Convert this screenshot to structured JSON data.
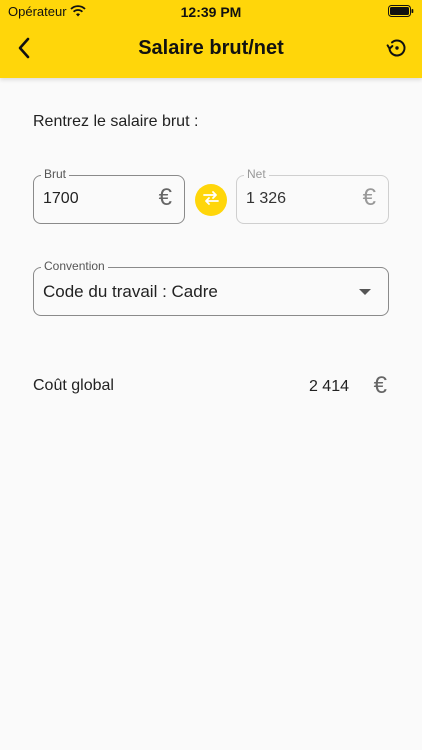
{
  "status_bar": {
    "carrier": "Opérateur",
    "time": "12:39 PM"
  },
  "nav": {
    "title": "Salaire brut/net",
    "back_icon": "chevron-left-icon",
    "history_icon": "history-icon"
  },
  "prompt": "Rentrez le salaire brut :",
  "brut": {
    "label": "Brut",
    "value": "1700",
    "currency": "€"
  },
  "net": {
    "label": "Net",
    "value": "1 326",
    "currency": "€"
  },
  "convention": {
    "label": "Convention",
    "value": "Code du travail : Cadre"
  },
  "cost": {
    "label": "Coût global",
    "value": "2 414",
    "currency": "€"
  },
  "colors": {
    "accent": "#ffd60a",
    "background": "#fafafa"
  }
}
